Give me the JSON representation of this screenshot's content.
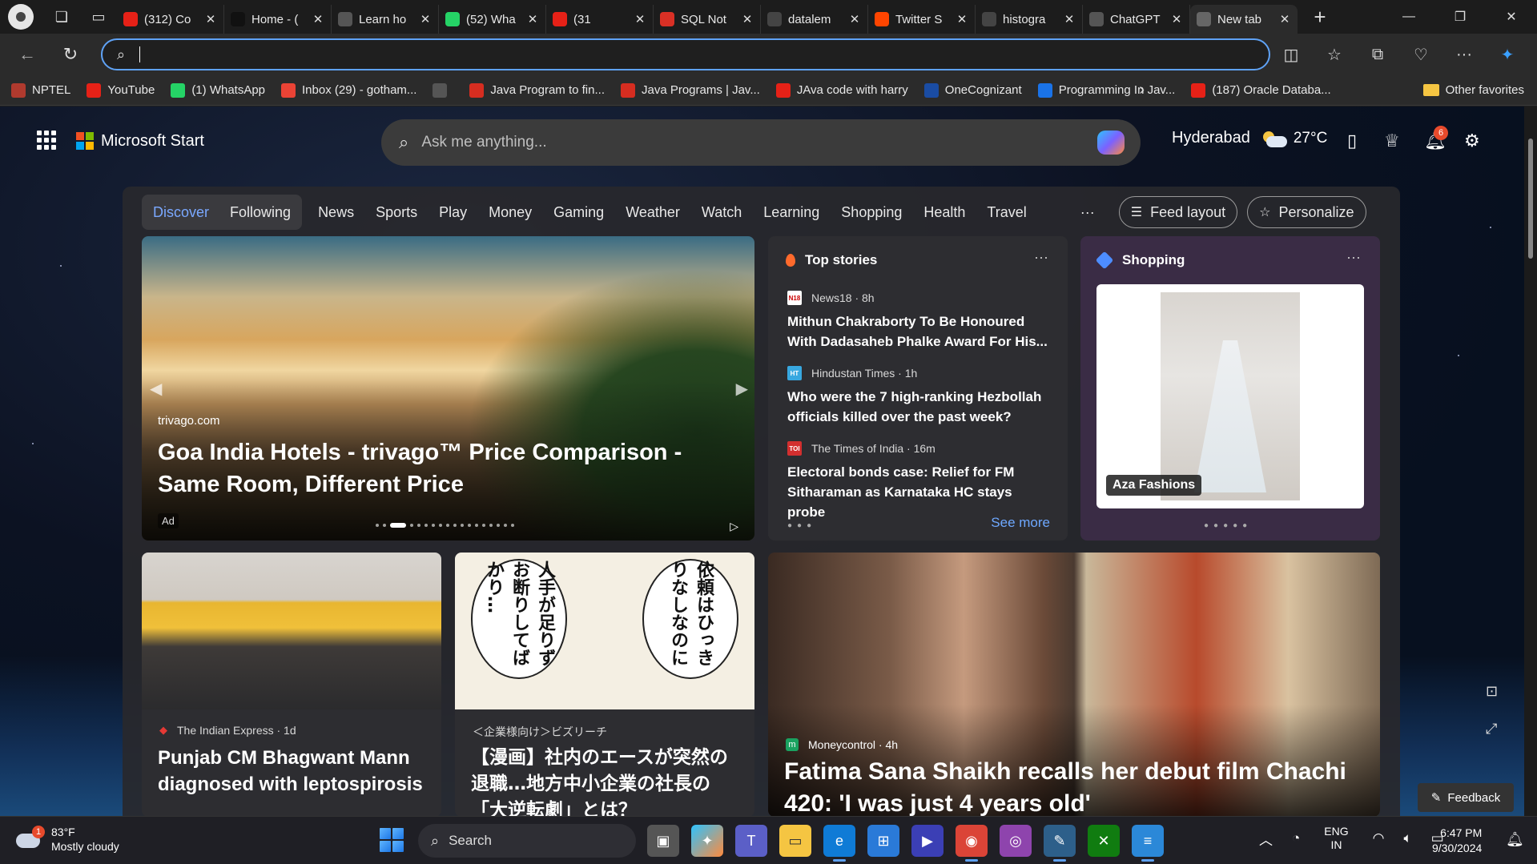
{
  "browser": {
    "tabs": [
      {
        "label": "(312) Co",
        "icon": "youtube-icon",
        "color": "#e62117"
      },
      {
        "label": "Home - (",
        "icon": "threads-icon",
        "color": "#111111"
      },
      {
        "label": "Learn ho",
        "icon": "site-icon",
        "color": "#555555"
      },
      {
        "label": "(52) Wha",
        "icon": "whatsapp-icon",
        "color": "#25d366"
      },
      {
        "label": "(31",
        "icon": "youtube-icon",
        "color": "#e62117"
      },
      {
        "label": "SQL Not",
        "icon": "pdf-icon",
        "color": "#d93025"
      },
      {
        "label": "datalem",
        "icon": "search-icon",
        "color": "#444444"
      },
      {
        "label": "Twitter S",
        "icon": "reddit-icon",
        "color": "#ff4500"
      },
      {
        "label": "histogra",
        "icon": "search-icon",
        "color": "#444444"
      },
      {
        "label": "ChatGPT",
        "icon": "chatgpt-icon",
        "color": "#555555"
      },
      {
        "label": "New tab",
        "icon": "newtab-icon",
        "color": "#666666",
        "active": true
      }
    ],
    "address": {
      "value": "",
      "placeholder": ""
    },
    "favorites": [
      {
        "label": "NPTEL",
        "icon": "nptel-icon",
        "color": "#b03a2e"
      },
      {
        "label": "YouTube",
        "icon": "youtube-icon",
        "color": "#e62117"
      },
      {
        "label": "(1) WhatsApp",
        "icon": "whatsapp-icon",
        "color": "#25d366"
      },
      {
        "label": "Inbox (29) - gotham...",
        "icon": "gmail-icon",
        "color": "#ea4335"
      },
      {
        "label": "",
        "icon": "page-icon",
        "color": "#555555"
      },
      {
        "label": "Java Program to fin...",
        "icon": "javatpoint-icon",
        "color": "#d62d20"
      },
      {
        "label": "Java Programs | Jav...",
        "icon": "javatpoint-icon",
        "color": "#d62d20"
      },
      {
        "label": "JAva code with harry",
        "icon": "youtube-icon",
        "color": "#e62117"
      },
      {
        "label": "OneCognizant",
        "icon": "cognizant-icon",
        "color": "#1a4ca3"
      },
      {
        "label": "Programming In Jav...",
        "icon": "site-icon",
        "color": "#1a73e8"
      },
      {
        "label": "(187) Oracle Databa...",
        "icon": "youtube-icon",
        "color": "#e62117"
      }
    ],
    "other_favorites": "Other favorites"
  },
  "header": {
    "brand": "Microsoft Start",
    "search_placeholder": "Ask me anything...",
    "city": "Hyderabad",
    "temperature": "27°C",
    "notification_count": "6"
  },
  "feed_tabs": {
    "segment": [
      "Discover",
      "Following"
    ],
    "nav": [
      "News",
      "Sports",
      "Play",
      "Money",
      "Gaming",
      "Weather",
      "Watch",
      "Learning",
      "Shopping",
      "Health",
      "Travel"
    ],
    "more": "···",
    "feed_layout": "Feed layout",
    "personalize": "Personalize"
  },
  "hero": {
    "source": "trivago.com",
    "title": "Goa India Hotels - trivago™ Price Comparison - Same Room, Different Price",
    "ad_label": "Ad",
    "slide_total": 18,
    "slide_active": 3
  },
  "top_stories": {
    "heading": "Top stories",
    "items": [
      {
        "publisher": "News18 · 8h",
        "badge": "N18",
        "badge_color": "#ffffff",
        "title": "Mithun Chakraborty To Be Honoured With Dadasaheb Phalke Award For His..."
      },
      {
        "publisher": "Hindustan Times · 1h",
        "badge": "HT",
        "badge_color": "#38a8e0",
        "title": "Who were the 7 high-ranking Hezbollah officials killed over the past week?"
      },
      {
        "publisher": "The Times of India · 16m",
        "badge": "TOI",
        "badge_color": "#d32f2f",
        "title": "Electoral bonds case: Relief for FM Sitharaman as Karnataka HC stays probe"
      }
    ],
    "see_more": "See more"
  },
  "shopping": {
    "heading": "Shopping",
    "brand": "Aza Fashions"
  },
  "cards": [
    {
      "publisher": "The Indian Express · 1d",
      "title": "Punjab CM Bhagwant Mann diagnosed with leptospirosis"
    },
    {
      "publisher": "＜企業様向け＞ビズリーチ",
      "title": "【漫画】社内のエースが突然の退職…地方中小企業の社長の「大逆転劇」とは？",
      "bubble1": "依頼はひっきりなしなのに",
      "bubble2": "人手が足りずお断りしてばかり…"
    },
    {
      "publisher": "Moneycontrol · 4h",
      "title": "Fatima Sana Shaikh recalls her debut film Chachi 420: 'I was just 4 years old'"
    }
  ],
  "feedback": "Feedback",
  "taskbar": {
    "weather_badge": "1",
    "weather_temp": "83°F",
    "weather_desc": "Mostly cloudy",
    "search_label": "Search",
    "lang": "ENG",
    "region": "IN",
    "time": "6:47 PM",
    "date": "9/30/2024"
  }
}
